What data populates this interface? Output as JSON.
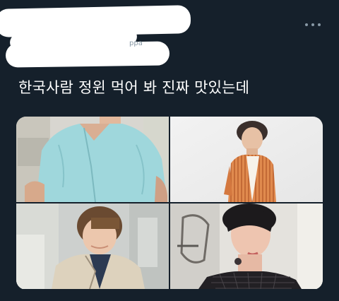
{
  "tweet": {
    "handle_fragment": "ppa",
    "text": "한국사람 정윈 먹어 봐 진짜 맛있는데"
  },
  "icons": {
    "more": "more-horizontal-icon"
  },
  "media": {
    "photos": [
      {
        "subject": "man in light blue linen shirt"
      },
      {
        "subject": "man in orange striped jacket with white backdrop"
      },
      {
        "subject": "smiling man in beige collared jacket"
      },
      {
        "subject": "man in black mesh top with neck tattoo"
      }
    ]
  },
  "colors": {
    "background": "#15202b",
    "text": "#ffffff",
    "muted": "#8899a6"
  }
}
